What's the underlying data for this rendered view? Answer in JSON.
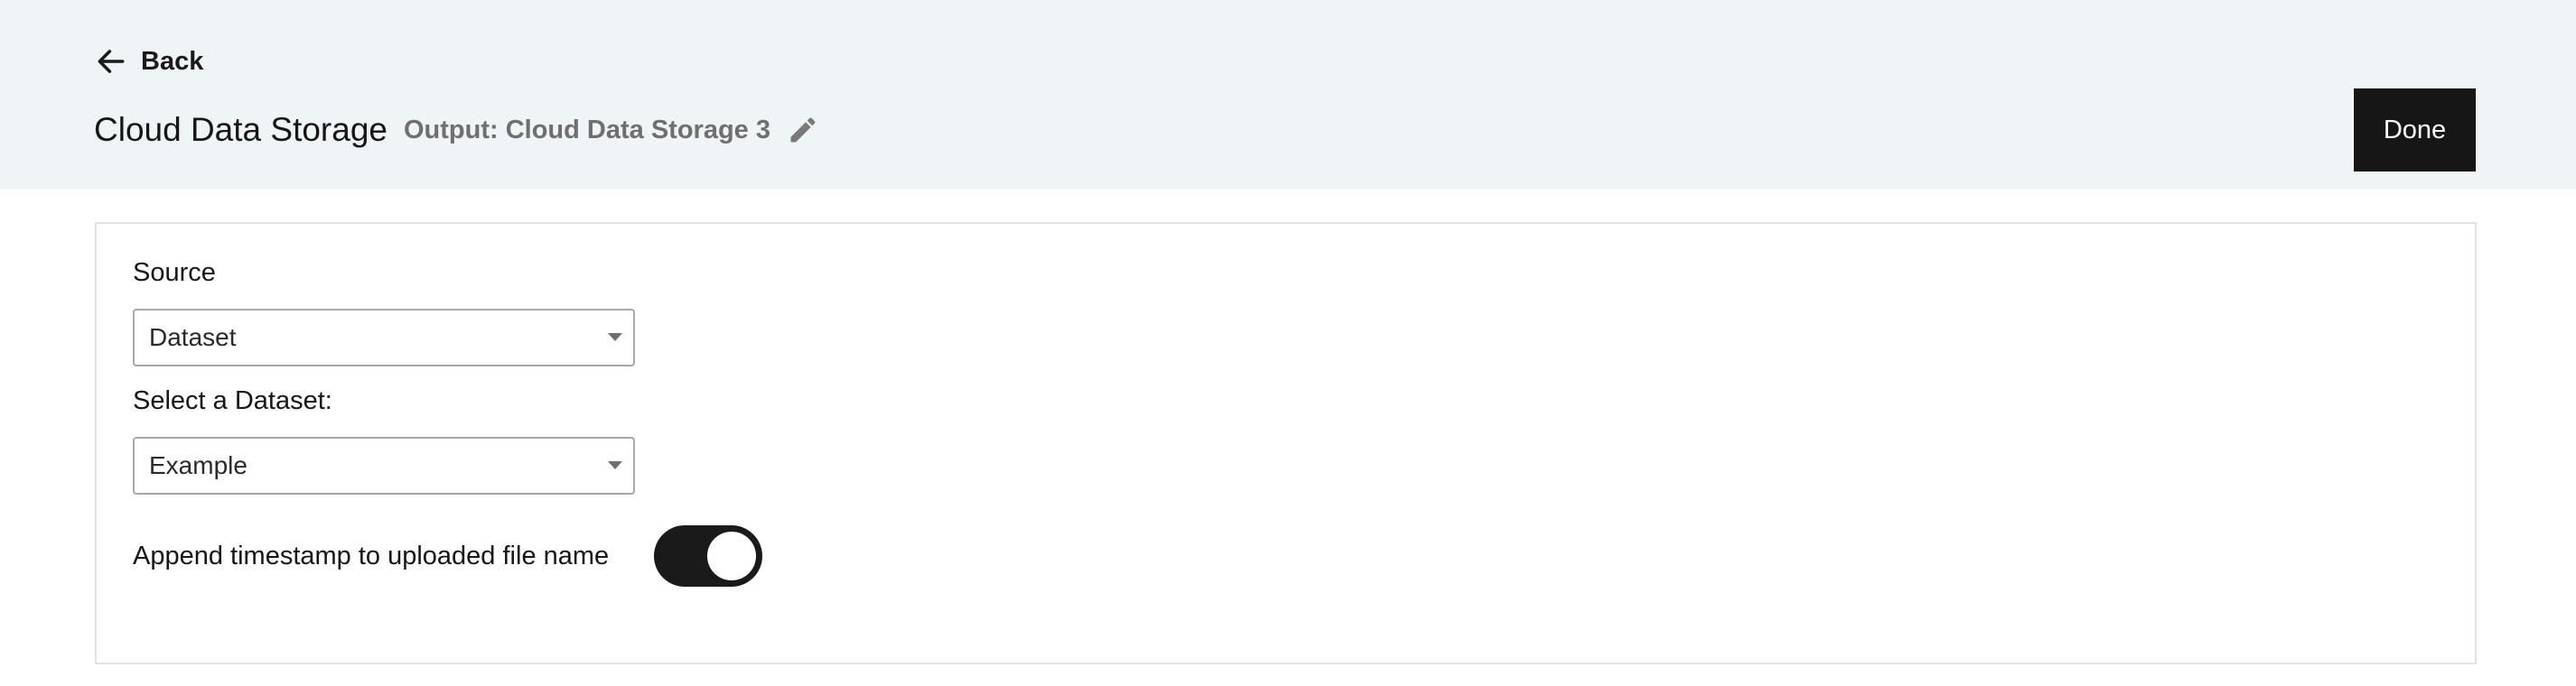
{
  "header": {
    "back_label": "Back",
    "title": "Cloud Data Storage",
    "output_label": "Output: Cloud Data Storage 3",
    "done_label": "Done"
  },
  "form": {
    "source": {
      "label": "Source",
      "value": "Dataset"
    },
    "dataset": {
      "label": "Select a Dataset:",
      "value": "Example"
    },
    "append_timestamp": {
      "label": "Append timestamp to uploaded file name",
      "enabled": true
    }
  },
  "icons": {
    "back": "arrow-left-icon",
    "edit": "pencil-icon",
    "dropdown": "caret-down-icon"
  },
  "colors": {
    "header_bg": "#eff4f6",
    "primary_button": "#161616",
    "toggle_on": "#1a1a1a",
    "muted_text": "#6f6f6f"
  }
}
